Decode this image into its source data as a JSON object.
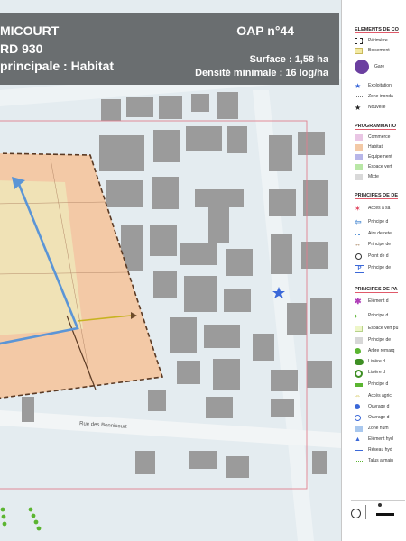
{
  "title": {
    "line1": "MICOURT",
    "line2": "RD 930",
    "line3": "principale : Habitat",
    "oap": "OAP n°44",
    "surface": "Surface : 1,58 ha",
    "density": "Densité minimale : 16 log/ha"
  },
  "map": {
    "street_label": "Rue des Bonnicourt",
    "colors": {
      "background": "#e4ecf0",
      "building": "#9b9b9b",
      "habitat_zone": "#f3c9a6",
      "habitat_zone_inner": "#f0e2b6",
      "perimeter": "#e0808e",
      "boundary": "#5a3a24",
      "circulation": "#5b95d6",
      "liaison": "#c7b321",
      "hedge": "#5bb531"
    },
    "symbols": {
      "heritage_star": "blue-star"
    }
  },
  "legend": {
    "elements_title": "ELEMENTS DE CO",
    "elements": [
      {
        "label": "Périmètre",
        "icon": "dashed-frame-icon"
      },
      {
        "label": "Boisement",
        "icon": "yellow-square-icon"
      },
      {
        "label": "Gare",
        "icon": "train-station-icon"
      },
      {
        "label": "Exploitation",
        "icon": "blue-star-icon"
      },
      {
        "label": "Zone inonda",
        "icon": "dotted-line-icon"
      },
      {
        "label": "Nouvelle",
        "icon": "black-star-icon"
      }
    ],
    "programmation_title": "PROGRAMMATIO",
    "programmation": [
      {
        "label": "Commerce",
        "color": "#e9c6e4"
      },
      {
        "label": "Habitat",
        "color": "#f3c9a6"
      },
      {
        "label": "Equipement",
        "color": "#b8b6e8"
      },
      {
        "label": "Espace vert",
        "color": "#b9e7a6"
      },
      {
        "label": "Mixte",
        "color": "#d9d9d9"
      }
    ],
    "desserte_title": "PRINCIPES DE DE",
    "desserte": [
      {
        "label": "Accès à sa",
        "icon": "red-star-icon"
      },
      {
        "label": "Principe d",
        "icon": "blue-arrow-icon"
      },
      {
        "label": "Aire de rete",
        "icon": "blue-dots-icon"
      },
      {
        "label": "Principe de",
        "icon": "brown-double-arrow-icon"
      },
      {
        "label": "Point de d",
        "icon": "point-icon"
      },
      {
        "label": "Principe de",
        "icon": "parking-icon"
      }
    ],
    "paysage_title": "PRINCIPES DE PA",
    "paysage": [
      {
        "label": "Elément d",
        "icon": "purple-asterisk-icon"
      },
      {
        "label": "Principe d",
        "icon": "green-chevron-icon"
      },
      {
        "label": "Espace vert pu",
        "icon": "light-green-square-icon"
      },
      {
        "label": "Principe de",
        "icon": "gray-square-icon"
      },
      {
        "label": "Arbre remarq",
        "icon": "green-circle-icon"
      },
      {
        "label": "Lisière d",
        "icon": "green-hedge-icon"
      },
      {
        "label": "Lisière d",
        "icon": "green-ring-icon"
      },
      {
        "label": "Principe d",
        "icon": "green-bar-icon"
      },
      {
        "label": "Accès agric",
        "icon": "yellow-arrow-icon"
      },
      {
        "label": "Ouvrage d",
        "icon": "blue-circle-icon"
      },
      {
        "label": "Ouvrage d",
        "icon": "blue-circle-outline-icon"
      },
      {
        "label": "Zone hum",
        "icon": "blue-square-icon"
      },
      {
        "label": "Elément hyd",
        "icon": "blue-triangle-icon"
      },
      {
        "label": "Réseau hyd",
        "icon": "blue-line-icon"
      },
      {
        "label": "Talus a main",
        "icon": "green-dotted-icon"
      }
    ]
  }
}
